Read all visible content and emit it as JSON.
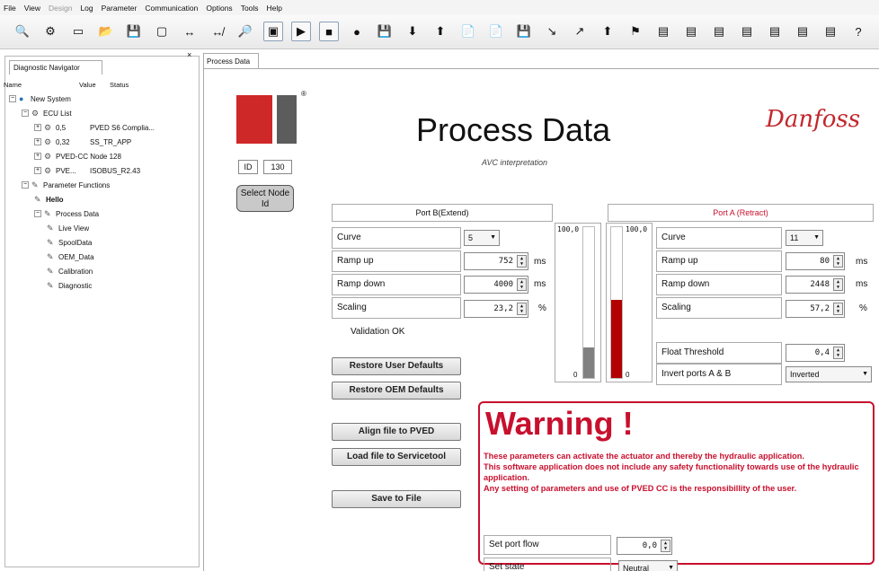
{
  "menu": [
    "File",
    "View",
    "Design",
    "Log",
    "Parameter",
    "Communication",
    "Options",
    "Tools",
    "Help"
  ],
  "menu_disabled": [
    "Design"
  ],
  "toolbar_icons": [
    "magnifier-icon",
    "network-icon",
    "blank-doc-icon",
    "open-folder-icon",
    "save-icon",
    "clipboard-icon",
    "connect-icon",
    "disconnect-icon",
    "search-node-icon",
    "monitor-icon",
    "play-icon",
    "stop-icon",
    "record-icon",
    "save-log-icon",
    "download-icon",
    "upload-icon",
    "file-open-icon",
    "file-save-icon",
    "disk-icon",
    "file-import-icon",
    "file-export-icon",
    "arrow-up-icon",
    "flag-icon",
    "db1-icon",
    "db2-icon",
    "db3-icon",
    "db4-icon",
    "db5-icon",
    "db6-icon",
    "db7-icon",
    "help-icon"
  ],
  "navigator": {
    "tab_label": "Diagnostic Navigator",
    "close_glyph": "×",
    "columns": {
      "name": "Name",
      "value": "Value",
      "status": "Status"
    },
    "tree": [
      {
        "label": "New System",
        "depth": 0,
        "expander": "−",
        "icon": "globe-icon",
        "glyph": "●"
      },
      {
        "label": "ECU List",
        "depth": 1,
        "expander": "−",
        "icon": "ecu-list-icon",
        "glyph": "⚙"
      },
      {
        "label": "0,5",
        "value": "PVED S6 Complia...",
        "depth": 2,
        "expander": "+",
        "icon": "ecu-icon",
        "glyph": "⚙"
      },
      {
        "label": "0,32",
        "value": "SS_TR_APP",
        "depth": 2,
        "expander": "+",
        "icon": "ecu-icon",
        "glyph": "⚙"
      },
      {
        "label": "PVED-CC Node 128",
        "depth": 2,
        "expander": "+",
        "icon": "ecu-icon",
        "glyph": "⚙"
      },
      {
        "label": "PVE...",
        "value": "ISOBUS_R2.43",
        "depth": 2,
        "expander": "+",
        "icon": "ecu-icon",
        "glyph": "⚙"
      },
      {
        "label": "Parameter Functions",
        "depth": 1,
        "expander": "−",
        "icon": "function-icon",
        "glyph": "✎"
      },
      {
        "label": "Hello",
        "depth": 2,
        "bold": true,
        "icon": "function-icon",
        "glyph": "✎"
      },
      {
        "label": "Process Data",
        "depth": 2,
        "expander": "−",
        "icon": "function-icon",
        "glyph": "✎"
      },
      {
        "label": "Live View",
        "depth": 3,
        "icon": "function-icon",
        "glyph": "✎"
      },
      {
        "label": "SpoolData",
        "depth": 3,
        "icon": "function-icon",
        "glyph": "✎"
      },
      {
        "label": "OEM_Data",
        "depth": 3,
        "icon": "function-icon",
        "glyph": "✎"
      },
      {
        "label": "Calibration",
        "depth": 3,
        "icon": "function-icon",
        "glyph": "✎"
      },
      {
        "label": "Diagnostic",
        "depth": 3,
        "icon": "function-icon",
        "glyph": "✎"
      }
    ]
  },
  "content_tab": "Process Data",
  "header": {
    "title": "Process Data",
    "subtitle": "AVC interpretation",
    "brand": "Danfoss",
    "reg": "®"
  },
  "id_label": "ID",
  "id_value": "130",
  "select_node_label": "Select Node Id",
  "port_b": {
    "title": "Port B(Extend)",
    "curve_label": "Curve",
    "curve_value": "5",
    "ramp_up_label": "Ramp up",
    "ramp_up_value": "752",
    "ramp_up_unit": "ms",
    "ramp_down_label": "Ramp down",
    "ramp_down_value": "4000",
    "ramp_down_unit": "ms",
    "scaling_label": "Scaling",
    "scaling_value": "23,2",
    "scaling_unit": "%",
    "bar_max": "100,0",
    "bar_min": "0",
    "bar_level": 0.2,
    "bar_color": "#808080"
  },
  "port_a": {
    "title": "Port A (Retract)",
    "title_color": "#c8102e",
    "curve_label": "Curve",
    "curve_value": "11",
    "ramp_up_label": "Ramp up",
    "ramp_up_value": "80",
    "ramp_up_unit": "ms",
    "ramp_down_label": "Ramp down",
    "ramp_down_value": "2448",
    "ramp_down_unit": "ms",
    "scaling_label": "Scaling",
    "scaling_value": "57,2",
    "scaling_unit": "%",
    "float_label": "Float Threshold",
    "float_value": "0,4",
    "invert_label": "Invert ports A & B",
    "invert_value": "Inverted",
    "bar_max": "100,0",
    "bar_min": "0",
    "bar_level": 0.52,
    "bar_color": "#b30000"
  },
  "validation": "Validation OK",
  "buttons": {
    "restore_user": "Restore User Defaults",
    "restore_oem": "Restore OEM Defaults",
    "align": "Align file to PVED",
    "load": "Load file to Servicetool",
    "save": "Save to File"
  },
  "warning": {
    "title": "Warning !",
    "lines": [
      "These parameters can activate the actuator and thereby the hydraulic application.",
      "This software application does not include any safety functionality towards use of the hydraulic application.",
      "Any setting of parameters and use of PVED CC is the responsibillity of the user."
    ],
    "set_port_flow_label": "Set port flow",
    "set_port_flow_value": "0,0",
    "set_state_label": "Set state",
    "set_state_value": "Neutral"
  },
  "colors": {
    "accent": "#c8102e",
    "logo_red": "#cf2828",
    "logo_gray": "#5c5c5c"
  }
}
